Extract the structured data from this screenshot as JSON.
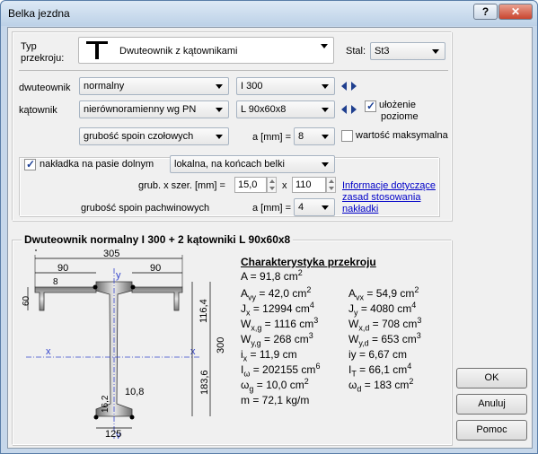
{
  "window": {
    "title": "Belka jezdna",
    "help_label": "?",
    "close_label": "✕"
  },
  "top": {
    "type_label_1": "Typ",
    "type_label_2": "przekroju:",
    "type_value": "Dwuteownik z kątownikami",
    "steel_label": "Stal:",
    "steel_value": "St3"
  },
  "profile": {
    "dwuteownik_label": "dwuteownik",
    "dwuteownik_kind": "normalny",
    "dwuteownik_size": "I 300",
    "katownik_label": "kątownik",
    "katownik_kind": "nierównoramienny wg PN",
    "katownik_size": "L 90x60x8",
    "ulozenie_1": "ułożenie",
    "ulozenie_2": "poziome",
    "spoina_type": "grubość spoin czołowych",
    "a_label": "a [mm] =",
    "a_value": "8",
    "max_label": "wartość maksymalna"
  },
  "nakladka": {
    "label": "nakładka na pasie dolnym",
    "mode": "lokalna, na końcach belki",
    "grub_label": "grub. x szer.  [mm] =",
    "grub_value": "15,0",
    "x_label": "x",
    "szer_value": "110",
    "info_1": "Informacje dotyczące",
    "info_2": "zasad stosowania",
    "info_3": "nakładki",
    "pach_label": "grubość spoin pachwinowych",
    "pach_a_label": "a [mm] =",
    "pach_value": "4"
  },
  "section": {
    "title": "Dwuteownik normalny I 300 + 2 kątowniki L 90x60x8",
    "char_title": "Charakterystyka przekroju",
    "A": "A = 91,8 cm",
    "A_exp": "2",
    "Avy": "A",
    "Avy_sub": "vy",
    "Avy_val": " = 42,0 cm",
    "Avy_exp": "2",
    "Avx": "A",
    "Avx_sub": "vx",
    "Avx_val": " = 54,9 cm",
    "Avx_exp": "2",
    "Jx": "J",
    "Jx_sub": "x",
    "Jx_val": " = 12994 cm",
    "Jx_exp": "4",
    "Jy": "J",
    "Jy_sub": "y",
    "Jy_val": " = 4080 cm",
    "Jy_exp": "4",
    "Wxg": "W",
    "Wxg_sub": "x,g",
    "Wxg_val": " = 1116 cm",
    "Wxg_exp": "3",
    "Wxd": "W",
    "Wxd_sub": "x,d",
    "Wxd_val": " = 708 cm",
    "Wxd_exp": "3",
    "Wyg": "W",
    "Wyg_sub": "y,g",
    "Wyg_val": " = 268 cm",
    "Wyg_exp": "3",
    "Wyd": "W",
    "Wyd_sub": "y,d",
    "Wyd_val": " = 653 cm",
    "Wyd_exp": "3",
    "ix": "i",
    "ix_sub": "x",
    "ix_val": " = 11,9 cm",
    "iy": "iy = 6,67 cm",
    "Iw": "I",
    "Iw_sub": "ω",
    "Iw_val": " = 202155 cm",
    "Iw_exp": "6",
    "IT": "I",
    "IT_sub": "T",
    "IT_val": " = 66,1 cm",
    "IT_exp": "4",
    "wg": "ω",
    "wg_sub": "g",
    "wg_val": " = 10,0 cm",
    "wg_exp": "2",
    "wd": "ω",
    "wd_sub": "d",
    "wd_val": " = 183 cm",
    "wd_exp": "2",
    "m": "m = 72,1 kg/m"
  },
  "drawing": {
    "dim_305": "305",
    "dim_90a": "90",
    "dim_90b": "90",
    "dim_60": "60",
    "dim_8": "8",
    "dim_300": "300",
    "dim_116": "116,4",
    "dim_183": "183,6",
    "dim_108": "10,8",
    "dim_162": "16,2",
    "dim_125": "125",
    "axis_y": "y",
    "axis_x": "x"
  },
  "buttons": {
    "ok": "OK",
    "cancel": "Anuluj",
    "help": "Pomoc"
  }
}
